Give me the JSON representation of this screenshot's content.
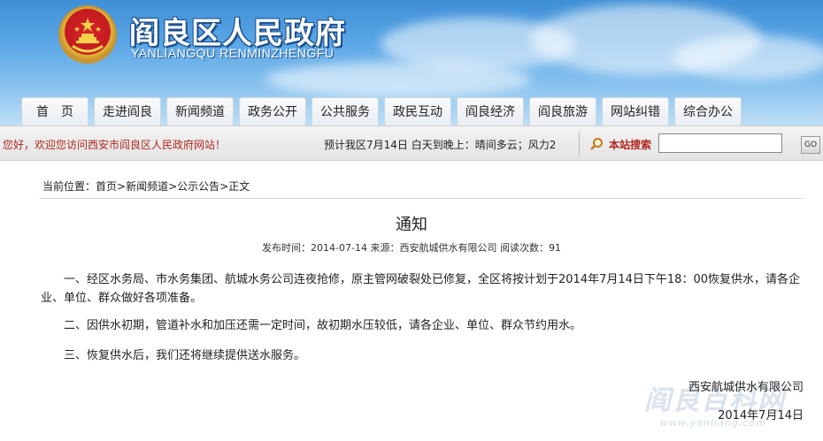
{
  "header": {
    "title": "阎良区人民政府",
    "subtitle": "YANLIANGQU RENMINZHENGFU"
  },
  "nav": {
    "items": [
      {
        "label": "首　页"
      },
      {
        "label": "走进阎良"
      },
      {
        "label": "新闻频道"
      },
      {
        "label": "政务公开"
      },
      {
        "label": "公共服务"
      },
      {
        "label": "政民互动"
      },
      {
        "label": "阎良经济"
      },
      {
        "label": "阎良旅游"
      },
      {
        "label": "网站纠错"
      },
      {
        "label": "综合办公"
      }
    ]
  },
  "infobar": {
    "welcome": "您好，欢迎您访问西安市阎良区人民政府网站！",
    "weather": "预计我区7月14日  白天到晚上：晴间多云；风力2",
    "search_label": "本站搜索",
    "search_value": "",
    "go_label": "GO"
  },
  "breadcrumb": {
    "prefix": "当前位置：",
    "items": [
      "首页",
      "新闻频道",
      "公示公告"
    ],
    "current": "正文",
    "separator": ">"
  },
  "article": {
    "title": "通知",
    "meta": "发布时间：2014-07-14  来源：西安航城供水有限公司  阅读次数：91",
    "paragraphs": [
      "一、经区水务局、市水务集团、航城水务公司连夜抢修，原主管网破裂处已修复，全区将按计划于2014年7月14日下午18：00恢复供水，请各企业、单位、群众做好各项准备。",
      "二、因供水初期，管道补水和加压还需一定时间，故初期水压较低，请各企业、单位、群众节约用水。",
      "三、恢复供水后，我们还将继续提供送水服务。"
    ],
    "signature_org": "西安航城供水有限公司",
    "signature_date": "2014年7月14日"
  },
  "watermark": {
    "text": "阎良百科网",
    "url": "www.yanliang.com"
  },
  "colors": {
    "header_sky": "#5aa6e6",
    "title_outline": "#1c4f8d",
    "accent_red": "#b0271f"
  }
}
